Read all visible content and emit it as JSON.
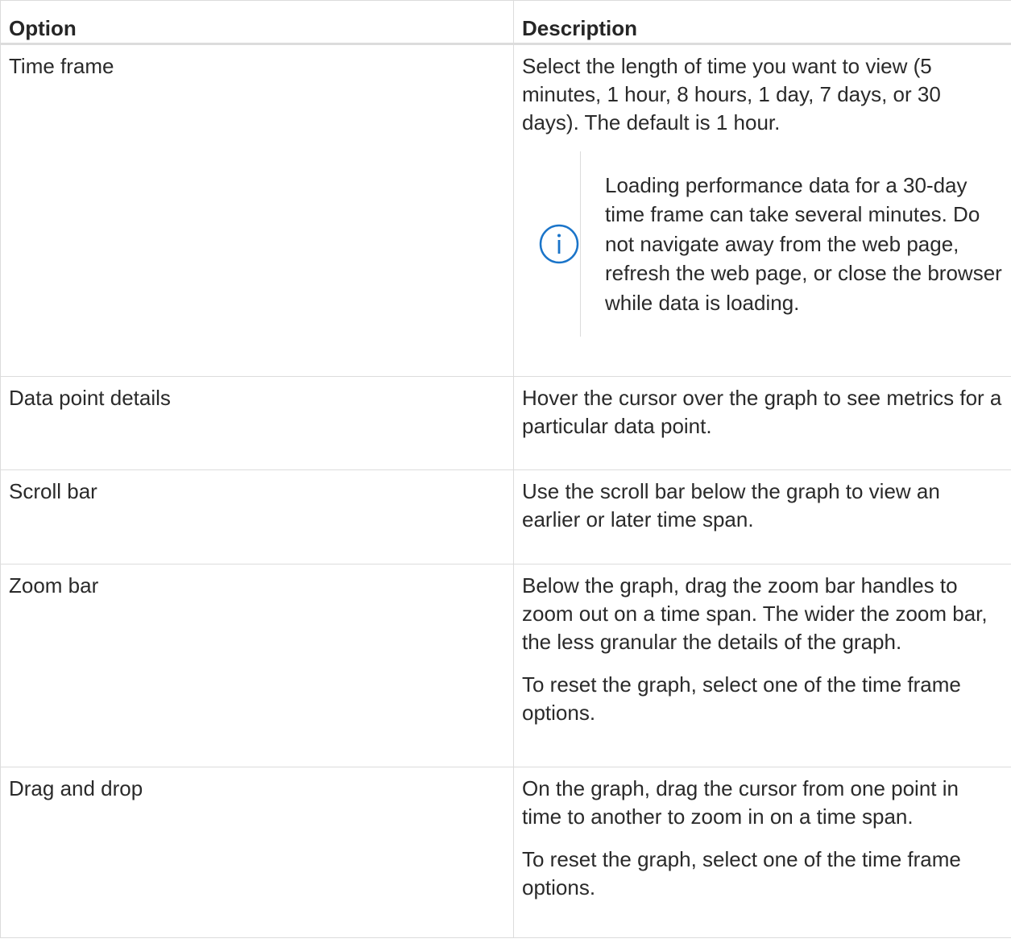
{
  "table": {
    "headers": {
      "option": "Option",
      "description": "Description"
    },
    "rows": [
      {
        "option": "Time frame",
        "paragraphs": [
          "Select the length of time you want to view (5 minutes, 1 hour, 8 hours, 1 day, 7 days, or 30 days). The default is 1 hour."
        ],
        "note": {
          "icon": "info-icon",
          "text": "Loading performance data for a 30-day time frame can take several minutes. Do not navigate away from the web page, refresh the web page, or close the browser while data is loading."
        }
      },
      {
        "option": "Data point details",
        "paragraphs": [
          "Hover the cursor over the graph to see metrics for a particular data point."
        ]
      },
      {
        "option": "Scroll bar",
        "paragraphs": [
          "Use the scroll bar below the graph to view an earlier or later time span."
        ]
      },
      {
        "option": "Zoom bar",
        "paragraphs": [
          "Below the graph, drag the zoom bar handles to zoom out on a time span. The wider the zoom bar, the less granular the details of the graph.",
          "To reset the graph, select one of the time frame options."
        ]
      },
      {
        "option": "Drag and drop",
        "paragraphs": [
          "On the graph, drag the cursor from one point in time to another to zoom in on a time span.",
          "To reset the graph, select one of the time frame options."
        ]
      }
    ]
  },
  "colors": {
    "info_icon": "#1a74c9",
    "border": "#dcdcdc",
    "text": "#2a2a2a"
  }
}
